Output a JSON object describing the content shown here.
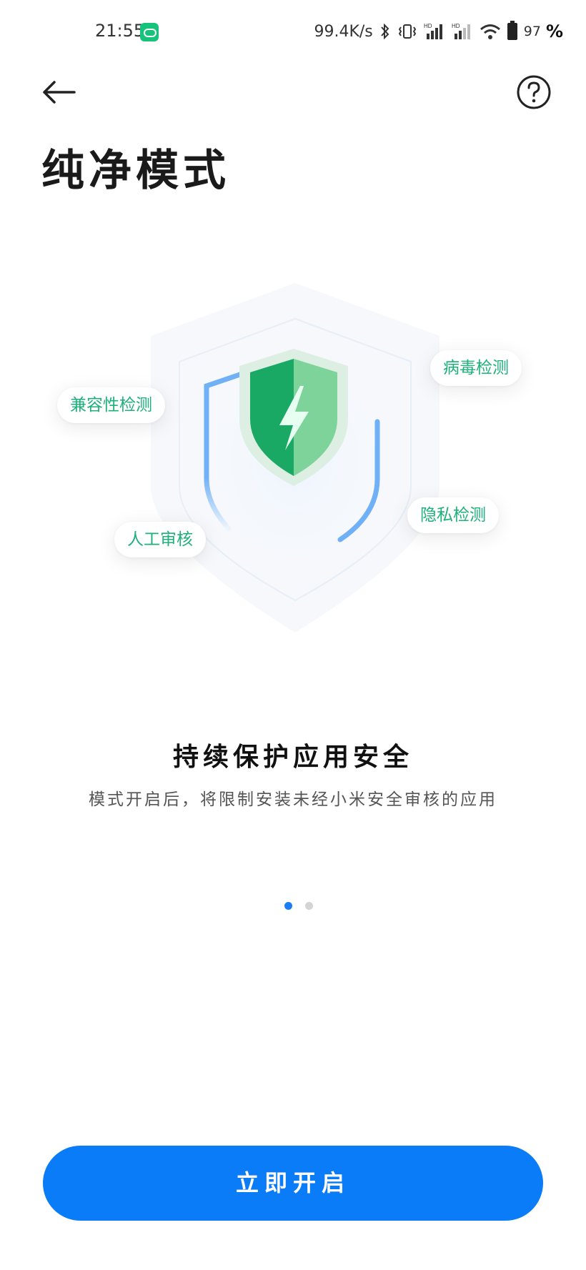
{
  "status_bar": {
    "time": "21:55",
    "network_speed": "99.4K/s",
    "battery_level": "97",
    "percent_sign": "%",
    "icons": [
      "app-notification-icon",
      "bluetooth-icon",
      "vibrate-icon",
      "signal-hd-icon",
      "signal-hd-icon",
      "wifi-icon",
      "battery-icon"
    ]
  },
  "header": {
    "back_icon": "arrow-left-icon",
    "help_icon": "question-circle-icon",
    "title": "纯净模式"
  },
  "illustration": {
    "chips": {
      "compatibility": "兼容性检测",
      "virus": "病毒检测",
      "privacy": "隐私检测",
      "manual": "人工审核"
    },
    "colors": {
      "chip_text": "#1db07a",
      "shield_green": "#1aa865",
      "shield_light_green": "#7dd39a",
      "outline_blue": "#6fb0f6"
    }
  },
  "content": {
    "headline": "持续保护应用安全",
    "description": "模式开启后，将限制安装未经小米安全审核的应用"
  },
  "pager": {
    "total": 2,
    "current": 1
  },
  "actions": {
    "enable_label": "立即开启"
  },
  "colors": {
    "accent": "#0b7cf7",
    "pager_active": "#1c7ef5",
    "pager_inactive": "#d4d4d4"
  }
}
